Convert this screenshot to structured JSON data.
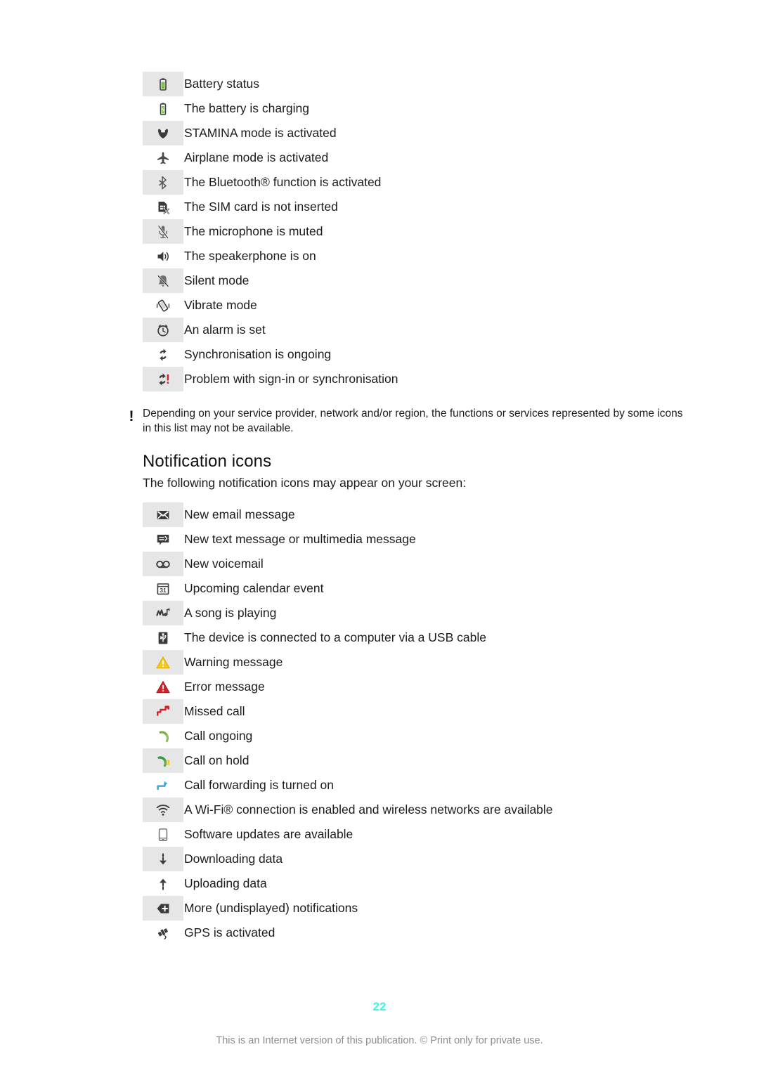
{
  "status_icons": {
    "rows": [
      {
        "icon": "battery-status-icon",
        "label": "Battery status",
        "shaded": true
      },
      {
        "icon": "battery-charging-icon",
        "label": "The battery is charging",
        "shaded": false
      },
      {
        "icon": "stamina-mode-icon",
        "label": "STAMINA mode is activated",
        "shaded": true
      },
      {
        "icon": "airplane-mode-icon",
        "label": "Airplane mode is activated",
        "shaded": false
      },
      {
        "icon": "bluetooth-icon",
        "label": "The Bluetooth® function is activated",
        "shaded": true
      },
      {
        "icon": "sim-card-missing-icon",
        "label": "The SIM card is not inserted",
        "shaded": false
      },
      {
        "icon": "microphone-muted-icon",
        "label": "The microphone is muted",
        "shaded": true
      },
      {
        "icon": "speakerphone-icon",
        "label": "The speakerphone is on",
        "shaded": false
      },
      {
        "icon": "silent-mode-icon",
        "label": "Silent mode",
        "shaded": true
      },
      {
        "icon": "vibrate-mode-icon",
        "label": "Vibrate mode",
        "shaded": false
      },
      {
        "icon": "alarm-icon",
        "label": "An alarm is set",
        "shaded": true
      },
      {
        "icon": "sync-ongoing-icon",
        "label": "Synchronisation is ongoing",
        "shaded": false
      },
      {
        "icon": "sync-problem-icon",
        "label": "Problem with sign-in or synchronisation",
        "shaded": true
      }
    ]
  },
  "note": {
    "mark": "!",
    "text": "Depending on your service provider, network and/or region, the functions or services represented by some icons in this list may not be available."
  },
  "notification_section": {
    "heading": "Notification icons",
    "intro": "The following notification icons may appear on your screen:",
    "rows": [
      {
        "icon": "new-email-icon",
        "label": "New email message",
        "shaded": true
      },
      {
        "icon": "new-text-message-icon",
        "label": "New text message or multimedia message",
        "shaded": false
      },
      {
        "icon": "new-voicemail-icon",
        "label": "New voicemail",
        "shaded": true
      },
      {
        "icon": "calendar-event-icon",
        "label": "Upcoming calendar event",
        "shaded": false
      },
      {
        "icon": "music-playing-icon",
        "label": "A song is playing",
        "shaded": true
      },
      {
        "icon": "usb-connected-icon",
        "label": "The device is connected to a computer via a USB cable",
        "shaded": false
      },
      {
        "icon": "warning-icon",
        "label": "Warning message",
        "shaded": true
      },
      {
        "icon": "error-icon",
        "label": "Error message",
        "shaded": false
      },
      {
        "icon": "missed-call-icon",
        "label": "Missed call",
        "shaded": true
      },
      {
        "icon": "call-ongoing-icon",
        "label": "Call ongoing",
        "shaded": false
      },
      {
        "icon": "call-on-hold-icon",
        "label": "Call on hold",
        "shaded": true
      },
      {
        "icon": "call-forwarding-icon",
        "label": "Call forwarding is turned on",
        "shaded": false
      },
      {
        "icon": "wifi-icon",
        "label": "A Wi-Fi® connection is enabled and wireless networks are available",
        "shaded": true
      },
      {
        "icon": "software-update-icon",
        "label": "Software updates are available",
        "shaded": false
      },
      {
        "icon": "downloading-icon",
        "label": "Downloading data",
        "shaded": true
      },
      {
        "icon": "uploading-icon",
        "label": "Uploading data",
        "shaded": false
      },
      {
        "icon": "more-notifications-icon",
        "label": "More (undisplayed) notifications",
        "shaded": true
      },
      {
        "icon": "gps-icon",
        "label": "GPS is activated",
        "shaded": false
      }
    ]
  },
  "footer": {
    "page_number": "22",
    "disclaimer": "This is an Internet version of this publication. © Print only for private use."
  },
  "colors": {
    "shaded_cell": "#e6e6e6",
    "page_number": "#3ff5e0",
    "footer_text": "#8c8c8c",
    "icon_dark": "#3b3b3b",
    "warning_yellow": "#f5c518",
    "error_red": "#d8202a",
    "call_green": "#7cb342",
    "forward_blue": "#3ba7e0",
    "battery_green": "#7cc242"
  }
}
